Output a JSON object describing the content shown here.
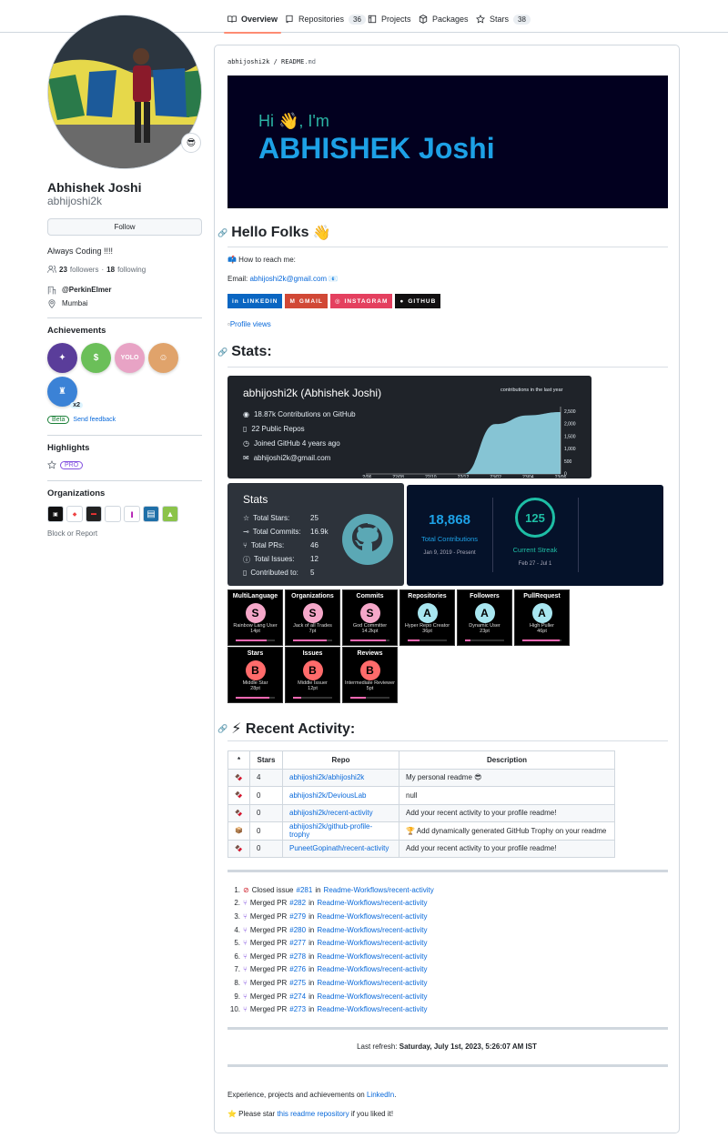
{
  "nav": {
    "tabs": [
      {
        "label": "Overview",
        "count": null
      },
      {
        "label": "Repositories",
        "count": "36"
      },
      {
        "label": "Projects",
        "count": null
      },
      {
        "label": "Packages",
        "count": null
      },
      {
        "label": "Stars",
        "count": "38"
      }
    ]
  },
  "profile": {
    "status_emoji": "😎",
    "name": "Abhishek Joshi",
    "login": "abhijoshi2k",
    "follow_label": "Follow",
    "bio": "Always Coding !!!!",
    "followers_count": "23",
    "followers_label": "followers",
    "following_count": "18",
    "following_label": "following",
    "company": "@PerkinElmer",
    "location": "Mumbai"
  },
  "achievements": {
    "title": "Achievements",
    "items": [
      {
        "name": "achievement-1",
        "color": "#5a3d9a",
        "glyph": "✦",
        "multiplier": ""
      },
      {
        "name": "achievement-2",
        "color": "#6bbf59",
        "glyph": "$",
        "multiplier": ""
      },
      {
        "name": "achievement-3",
        "color": "#e8a3c5",
        "glyph": "YOLO",
        "multiplier": ""
      },
      {
        "name": "achievement-4",
        "color": "#e0a36b",
        "glyph": "☺",
        "multiplier": ""
      },
      {
        "name": "achievement-5",
        "color": "#3b82d6",
        "glyph": "♜",
        "multiplier": "x2"
      }
    ],
    "beta_label": "Beta",
    "feedback_label": "Send feedback"
  },
  "highlights": {
    "title": "Highlights",
    "pro_label": "PRO"
  },
  "organizations": {
    "title": "Organizations",
    "items": [
      {
        "name": "org-1",
        "color": "#111111",
        "glyph": "▣"
      },
      {
        "name": "org-2",
        "color": "#ffffff",
        "glyph": "◆"
      },
      {
        "name": "org-3",
        "color": "#222222",
        "glyph": "▬"
      },
      {
        "name": "org-4",
        "color": "#ffffff",
        "glyph": ""
      },
      {
        "name": "org-5",
        "color": "#ffffff",
        "glyph": "ı"
      },
      {
        "name": "org-6",
        "color": "#1e6fa8",
        "glyph": "▤"
      },
      {
        "name": "org-7",
        "color": "#8bc34a",
        "glyph": "▲"
      }
    ],
    "block_label": "Block or Report"
  },
  "readme": {
    "path_user": "abhijoshi2k",
    "path_sep": "/",
    "path_file": "README",
    "path_ext": ".md",
    "banner_hi": "Hi 👋, I'm",
    "banner_name": "ABHISHEK Joshi",
    "hello_heading": "Hello Folks",
    "hello_emoji": "👋",
    "reach_text": "📫 How to reach me:",
    "email_prefix": "Email: ",
    "email": "abhijoshi2k@gmail.com",
    "email_suffix": " 📧",
    "social": [
      {
        "label": "LINKEDIN",
        "color": "#0a66c2",
        "glyph": "in"
      },
      {
        "label": "GMAIL",
        "color": "#d14836",
        "glyph": "M"
      },
      {
        "label": "INSTAGRAM",
        "color": "#e4405f",
        "glyph": "◎"
      },
      {
        "label": "GITHUB",
        "color": "#121011",
        "glyph": "●"
      }
    ],
    "profile_views": "Profile views",
    "stats_heading": "Stats:",
    "recent_heading": "⚡ Recent Activity:",
    "last_refresh_label": "Last refresh: ",
    "last_refresh_value": "Saturday, July 1st, 2023, 5:26:07 AM IST",
    "footer_text": "Experience, projects and achievements on ",
    "footer_link": "LinkedIn",
    "footer_end": ".",
    "star_prefix": "⭐ Please star ",
    "star_link": "this readme repository",
    "star_suffix": " if you liked it!"
  },
  "gh_card": {
    "title": "abhijoshi2k (Abhishek Joshi)",
    "contributions": "18.87k Contributions on GitHub",
    "repos": "22 Public Repos",
    "joined": "Joined GitHub 4 years ago",
    "email": "abhijoshi2k@gmail.com",
    "chart_title": "contributions in the last year"
  },
  "stats_card": {
    "title": "Stats",
    "rows": [
      {
        "label": "Total Stars:",
        "value": "25"
      },
      {
        "label": "Total Commits:",
        "value": "16.9k"
      },
      {
        "label": "Total PRs:",
        "value": "46"
      },
      {
        "label": "Total Issues:",
        "value": "12"
      },
      {
        "label": "Contributed to:",
        "value": "5"
      }
    ]
  },
  "streak": {
    "total": "18,868",
    "total_label": "Total Contributions",
    "total_range": "Jan 9, 2019 - Present",
    "current": "125",
    "current_label": "Current Streak",
    "current_range": "Feb 27 - Jul 1"
  },
  "trophies": [
    {
      "title": "MultiLanguage",
      "rank": "S",
      "name": "Rainbow Lang User",
      "pt": "14pt",
      "progress": 0.8,
      "color": "#f5a7c9"
    },
    {
      "title": "Organizations",
      "rank": "S",
      "name": "Jack of all Trades",
      "pt": "7pt",
      "progress": 0.85,
      "color": "#f5a7c9"
    },
    {
      "title": "Commits",
      "rank": "S",
      "name": "God Committer",
      "pt": "14.2kpt",
      "progress": 0.9,
      "color": "#f5a7c9"
    },
    {
      "title": "Repositories",
      "rank": "A",
      "name": "Hyper Repo Creator",
      "pt": "36pt",
      "progress": 0.3,
      "color": "#a8e6f0"
    },
    {
      "title": "Followers",
      "rank": "A",
      "name": "Dynamic User",
      "pt": "23pt",
      "progress": 0.15,
      "color": "#a8e6f0"
    },
    {
      "title": "PullRequest",
      "rank": "A",
      "name": "High Puller",
      "pt": "46pt",
      "progress": 0.95,
      "color": "#a8e6f0"
    },
    {
      "title": "Stars",
      "rank": "B",
      "name": "Middle Star",
      "pt": "28pt",
      "progress": 0.85,
      "color": "#ff6b6b"
    },
    {
      "title": "Issues",
      "rank": "B",
      "name": "Middle Issuer",
      "pt": "12pt",
      "progress": 0.2,
      "color": "#ff6b6b"
    },
    {
      "title": "Reviews",
      "rank": "B",
      "name": "Intermediate Reviewer",
      "pt": "5pt",
      "progress": 0.4,
      "color": "#ff6b6b"
    }
  ],
  "activity_table": {
    "headers": [
      "*",
      "Stars",
      "Repo",
      "Description"
    ],
    "rows": [
      {
        "icon": "🍫",
        "stars": "4",
        "repo": "abhijoshi2k/abhijoshi2k",
        "desc": "My personal readme 😎"
      },
      {
        "icon": "🍫",
        "stars": "0",
        "repo": "abhijoshi2k/DeviousLab",
        "desc": "null"
      },
      {
        "icon": "🍫",
        "stars": "0",
        "repo": "abhijoshi2k/recent-activity",
        "desc": "Add your recent activity to your profile readme!"
      },
      {
        "icon": "📦",
        "stars": "0",
        "repo": "abhijoshi2k/github-profile-trophy",
        "desc": "🏆 Add dynamically generated GitHub Trophy on your readme"
      },
      {
        "icon": "🍫",
        "stars": "0",
        "repo": "PuneetGopinath/recent-activity",
        "desc": "Add your recent activity to your profile readme!"
      }
    ]
  },
  "events": [
    {
      "n": "1.",
      "type": "closed",
      "text": "Closed issue ",
      "num": "#281",
      "in": " in ",
      "repo": "Readme-Workflows/recent-activity"
    },
    {
      "n": "2.",
      "type": "merged",
      "text": "Merged PR ",
      "num": "#282",
      "in": " in ",
      "repo": "Readme-Workflows/recent-activity"
    },
    {
      "n": "3.",
      "type": "merged",
      "text": "Merged PR ",
      "num": "#279",
      "in": " in ",
      "repo": "Readme-Workflows/recent-activity"
    },
    {
      "n": "4.",
      "type": "merged",
      "text": "Merged PR ",
      "num": "#280",
      "in": " in ",
      "repo": "Readme-Workflows/recent-activity"
    },
    {
      "n": "5.",
      "type": "merged",
      "text": "Merged PR ",
      "num": "#277",
      "in": " in ",
      "repo": "Readme-Workflows/recent-activity"
    },
    {
      "n": "6.",
      "type": "merged",
      "text": "Merged PR ",
      "num": "#278",
      "in": " in ",
      "repo": "Readme-Workflows/recent-activity"
    },
    {
      "n": "7.",
      "type": "merged",
      "text": "Merged PR ",
      "num": "#276",
      "in": " in ",
      "repo": "Readme-Workflows/recent-activity"
    },
    {
      "n": "8.",
      "type": "merged",
      "text": "Merged PR ",
      "num": "#275",
      "in": " in ",
      "repo": "Readme-Workflows/recent-activity"
    },
    {
      "n": "9.",
      "type": "merged",
      "text": "Merged PR ",
      "num": "#274",
      "in": " in ",
      "repo": "Readme-Workflows/recent-activity"
    },
    {
      "n": "10.",
      "type": "merged",
      "text": "Merged PR ",
      "num": "#273",
      "in": " in ",
      "repo": "Readme-Workflows/recent-activity"
    }
  ],
  "chart_data": {
    "type": "area",
    "title": "contributions in the last year",
    "x": [
      "22/06",
      "22/08",
      "22/10",
      "22/12",
      "23/02",
      "23/04",
      "23/06"
    ],
    "yticks": [
      "0",
      "500",
      "1,000",
      "1,500",
      "2,000",
      "2,500"
    ],
    "ylim": [
      0,
      2700
    ],
    "series": [
      {
        "values": [
          0,
          0,
          0,
          0,
          2000,
          2350,
          2480
        ]
      }
    ]
  }
}
